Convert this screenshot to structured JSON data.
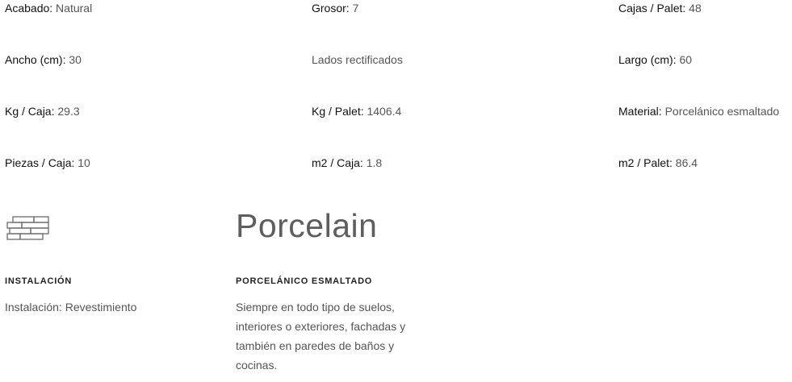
{
  "specs": {
    "acabado": {
      "label": "Acabado:",
      "value": " Natural"
    },
    "grosor": {
      "label": "Grosor:",
      "value": " 7"
    },
    "cajas_palet": {
      "label": "Cajas / Palet:",
      "value": " 48"
    },
    "ancho": {
      "label": "Ancho (cm):",
      "value": " 30"
    },
    "lados": {
      "label": "",
      "value": " Lados rectificados"
    },
    "largo": {
      "label": "Largo (cm):",
      "value": " 60"
    },
    "kg_caja": {
      "label": "Kg / Caja:",
      "value": " 29.3"
    },
    "kg_palet": {
      "label": "Kg / Palet:",
      "value": " 1406.4"
    },
    "material": {
      "label": "Material:",
      "value": " Porcelánico esmaltado"
    },
    "piezas_caja": {
      "label": "Piezas / Caja:",
      "value": " 10"
    },
    "m2_caja": {
      "label": "m2 / Caja:",
      "value": " 1.8"
    },
    "m2_palet": {
      "label": "m2 / Palet:",
      "value": " 86.4"
    }
  },
  "logo": {
    "text": "Porcelain"
  },
  "installation": {
    "icon": "brick-wall-icon",
    "heading": "INSTALACIÓN",
    "text": "Instalación: Revestimiento"
  },
  "porcelain": {
    "heading": "PORCELÁNICO ESMALTADO",
    "text": "Siempre en todo tipo de suelos, interiores o exteriores, fachadas y también en paredes de baños y cocinas."
  }
}
